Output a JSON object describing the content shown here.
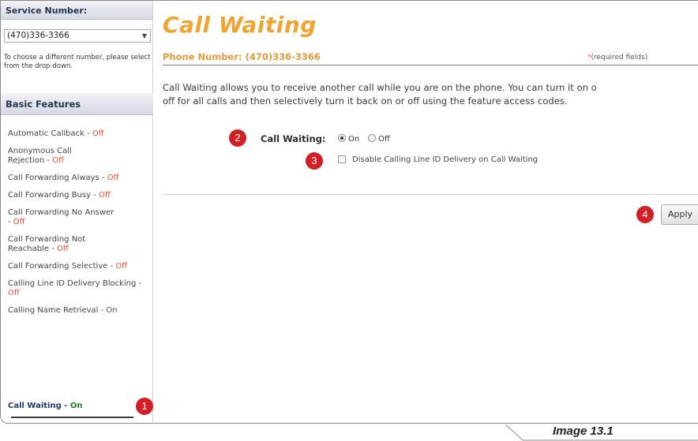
{
  "sidebar": {
    "service_header": "Service Number:",
    "selected_number": "(470)336-3366",
    "number_help": "To choose a different number, please select from the drop-down.",
    "basic_header": "Basic Features",
    "items": [
      {
        "name": "Automatic Callback",
        "sep": " - ",
        "status": "Off"
      },
      {
        "name": "Anonymous Call Rejection",
        "sep": " - ",
        "status": "Off"
      },
      {
        "name": "Call Forwarding Always",
        "sep": " - ",
        "status": "Off"
      },
      {
        "name": "Call Forwarding Busy",
        "sep": " - ",
        "status": "Off"
      },
      {
        "name": "Call Forwarding No Answer",
        "sep": " - ",
        "status": "Off"
      },
      {
        "name": "Call Forwarding Not Reachable",
        "sep": " - ",
        "status": "Off"
      },
      {
        "name": "Call Forwarding Selective",
        "sep": " - ",
        "status": "Off"
      },
      {
        "name": "Calling Line ID Delivery Blocking",
        "sep": " - ",
        "status": "Off"
      },
      {
        "name": "Calling Name Retrieval",
        "sep": " - ",
        "status": "On"
      }
    ],
    "active_item": {
      "name": "Call Waiting",
      "sep": " - ",
      "status": "On"
    }
  },
  "main": {
    "title": "Call Waiting",
    "phone_label": "Phone Number: (470)336-3366",
    "required_asterisk": "*",
    "required_note": "(required fields)",
    "description_line1": "Call Waiting allows you to receive another call while you are on the phone. You can turn it on o",
    "description_line2": "off for all calls and then selectively turn it back on or off using the feature access codes.",
    "call_waiting_label": "Call Waiting:",
    "radio_on": "On",
    "radio_off": "Off",
    "radio_selected": "On",
    "checkbox_label": "Disable Calling Line ID Delivery on Call Waiting",
    "checkbox_checked": false,
    "apply_label": "Apply"
  },
  "badges": {
    "one": "1",
    "two": "2",
    "three": "3",
    "four": "4"
  },
  "caption": "Image 13.1",
  "colors": {
    "title_orange": "#efa330",
    "status_off_red": "#e34c3a",
    "status_on_green": "#1e7d2a",
    "badge_red": "#d11f25"
  }
}
